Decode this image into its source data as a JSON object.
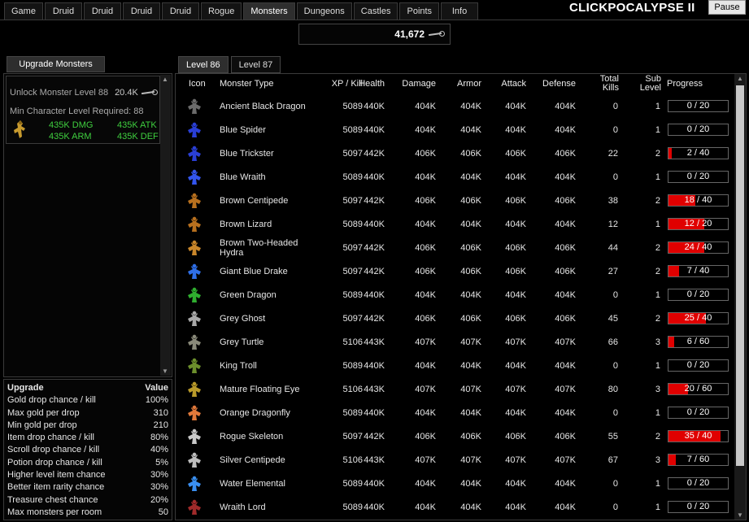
{
  "app_title": "CLICKPOCALYPSE II",
  "pause_label": "Pause",
  "nav_tabs": [
    "Game",
    "Druid",
    "Druid",
    "Druid",
    "Druid",
    "Rogue",
    "Monsters",
    "Dungeons",
    "Castles",
    "Points",
    "Info"
  ],
  "active_nav": "Monsters",
  "currency": {
    "value": "41,672",
    "icon": "bone-icon"
  },
  "left": {
    "tab_label": "Upgrade Monsters",
    "unlock_label": "Unlock Monster Level 88",
    "unlock_cost": "20.4K",
    "min_level_label": "Min Character Level Required: 88",
    "stats": {
      "dmg": "435K DMG",
      "atk": "435K ATK",
      "arm": "435K ARM",
      "def": "435K DEF"
    }
  },
  "upgrades": {
    "header": {
      "name": "Upgrade",
      "value": "Value"
    },
    "rows": [
      {
        "name": "Gold drop chance / kill",
        "value": "100%"
      },
      {
        "name": "Max gold per drop",
        "value": "310"
      },
      {
        "name": "Min gold per drop",
        "value": "210"
      },
      {
        "name": "Item drop chance / kill",
        "value": "80%"
      },
      {
        "name": "Scroll drop chance / kill",
        "value": "40%"
      },
      {
        "name": "Potion drop chance / kill",
        "value": "5%"
      },
      {
        "name": "Higher level item chance",
        "value": "30%"
      },
      {
        "name": "Better item rarity chance",
        "value": "30%"
      },
      {
        "name": "Treasure chest chance",
        "value": "20%"
      },
      {
        "name": "Max monsters per room",
        "value": "50"
      }
    ]
  },
  "level_tabs": [
    "Level 86",
    "Level 87"
  ],
  "active_level_tab": "Level 86",
  "table": {
    "headers": {
      "icon": "Icon",
      "type": "Monster Type",
      "xp": "XP / Kill",
      "health": "Health",
      "damage": "Damage",
      "armor": "Armor",
      "attack": "Attack",
      "defense": "Defense",
      "kills": "Total Kills",
      "sub": "Sub Level",
      "progress": "Progress"
    },
    "rows": [
      {
        "icon": "black-dragon-icon",
        "type": "Ancient Black Dragon",
        "xp": "5089",
        "health": "440K",
        "damage": "404K",
        "armor": "404K",
        "attack": "404K",
        "defense": "404K",
        "kills": "0",
        "sub": "1",
        "progress": "0 / 20",
        "frac": 0
      },
      {
        "icon": "blue-spider-icon",
        "type": "Blue Spider",
        "xp": "5089",
        "health": "440K",
        "damage": "404K",
        "armor": "404K",
        "attack": "404K",
        "defense": "404K",
        "kills": "0",
        "sub": "1",
        "progress": "0 / 20",
        "frac": 0
      },
      {
        "icon": "blue-trickster-icon",
        "type": "Blue Trickster",
        "xp": "5097",
        "health": "442K",
        "damage": "406K",
        "armor": "406K",
        "attack": "406K",
        "defense": "406K",
        "kills": "22",
        "sub": "2",
        "progress": "2 / 40",
        "frac": 0.05
      },
      {
        "icon": "blue-wraith-icon",
        "type": "Blue Wraith",
        "xp": "5089",
        "health": "440K",
        "damage": "404K",
        "armor": "404K",
        "attack": "404K",
        "defense": "404K",
        "kills": "0",
        "sub": "1",
        "progress": "0 / 20",
        "frac": 0
      },
      {
        "icon": "brown-centipede-icon",
        "type": "Brown Centipede",
        "xp": "5097",
        "health": "442K",
        "damage": "406K",
        "armor": "406K",
        "attack": "406K",
        "defense": "406K",
        "kills": "38",
        "sub": "2",
        "progress": "18 / 40",
        "frac": 0.45
      },
      {
        "icon": "brown-lizard-icon",
        "type": "Brown Lizard",
        "xp": "5089",
        "health": "440K",
        "damage": "404K",
        "armor": "404K",
        "attack": "404K",
        "defense": "404K",
        "kills": "12",
        "sub": "1",
        "progress": "12 / 20",
        "frac": 0.6
      },
      {
        "icon": "hydra-icon",
        "type": "Brown Two-Headed Hydra",
        "xp": "5097",
        "health": "442K",
        "damage": "406K",
        "armor": "406K",
        "attack": "406K",
        "defense": "406K",
        "kills": "44",
        "sub": "2",
        "progress": "24 / 40",
        "frac": 0.6
      },
      {
        "icon": "blue-drake-icon",
        "type": "Giant Blue Drake",
        "xp": "5097",
        "health": "442K",
        "damage": "406K",
        "armor": "406K",
        "attack": "406K",
        "defense": "406K",
        "kills": "27",
        "sub": "2",
        "progress": "7 / 40",
        "frac": 0.175
      },
      {
        "icon": "green-dragon-icon",
        "type": "Green Dragon",
        "xp": "5089",
        "health": "440K",
        "damage": "404K",
        "armor": "404K",
        "attack": "404K",
        "defense": "404K",
        "kills": "0",
        "sub": "1",
        "progress": "0 / 20",
        "frac": 0
      },
      {
        "icon": "grey-ghost-icon",
        "type": "Grey Ghost",
        "xp": "5097",
        "health": "442K",
        "damage": "406K",
        "armor": "406K",
        "attack": "406K",
        "defense": "406K",
        "kills": "45",
        "sub": "2",
        "progress": "25 / 40",
        "frac": 0.625
      },
      {
        "icon": "grey-turtle-icon",
        "type": "Grey Turtle",
        "xp": "5106",
        "health": "443K",
        "damage": "407K",
        "armor": "407K",
        "attack": "407K",
        "defense": "407K",
        "kills": "66",
        "sub": "3",
        "progress": "6 / 60",
        "frac": 0.1
      },
      {
        "icon": "king-troll-icon",
        "type": "King Troll",
        "xp": "5089",
        "health": "440K",
        "damage": "404K",
        "armor": "404K",
        "attack": "404K",
        "defense": "404K",
        "kills": "0",
        "sub": "1",
        "progress": "0 / 20",
        "frac": 0
      },
      {
        "icon": "floating-eye-icon",
        "type": "Mature Floating Eye",
        "xp": "5106",
        "health": "443K",
        "damage": "407K",
        "armor": "407K",
        "attack": "407K",
        "defense": "407K",
        "kills": "80",
        "sub": "3",
        "progress": "20 / 60",
        "frac": 0.333
      },
      {
        "icon": "dragonfly-icon",
        "type": "Orange Dragonfly",
        "xp": "5089",
        "health": "440K",
        "damage": "404K",
        "armor": "404K",
        "attack": "404K",
        "defense": "404K",
        "kills": "0",
        "sub": "1",
        "progress": "0 / 20",
        "frac": 0
      },
      {
        "icon": "skeleton-icon",
        "type": "Rogue Skeleton",
        "xp": "5097",
        "health": "442K",
        "damage": "406K",
        "armor": "406K",
        "attack": "406K",
        "defense": "406K",
        "kills": "55",
        "sub": "2",
        "progress": "35 / 40",
        "frac": 0.875
      },
      {
        "icon": "silver-centipede-icon",
        "type": "Silver Centipede",
        "xp": "5106",
        "health": "443K",
        "damage": "407K",
        "armor": "407K",
        "attack": "407K",
        "defense": "407K",
        "kills": "67",
        "sub": "3",
        "progress": "7 / 60",
        "frac": 0.117
      },
      {
        "icon": "water-elemental-icon",
        "type": "Water Elemental",
        "xp": "5089",
        "health": "440K",
        "damage": "404K",
        "armor": "404K",
        "attack": "404K",
        "defense": "404K",
        "kills": "0",
        "sub": "1",
        "progress": "0 / 20",
        "frac": 0
      },
      {
        "icon": "wraith-lord-icon",
        "type": "Wraith Lord",
        "xp": "5089",
        "health": "440K",
        "damage": "404K",
        "armor": "404K",
        "attack": "404K",
        "defense": "404K",
        "kills": "0",
        "sub": "1",
        "progress": "0 / 20",
        "frac": 0
      }
    ]
  },
  "colors": {
    "progress_fill": "#e00000",
    "stat_green": "#3fcf3f"
  }
}
